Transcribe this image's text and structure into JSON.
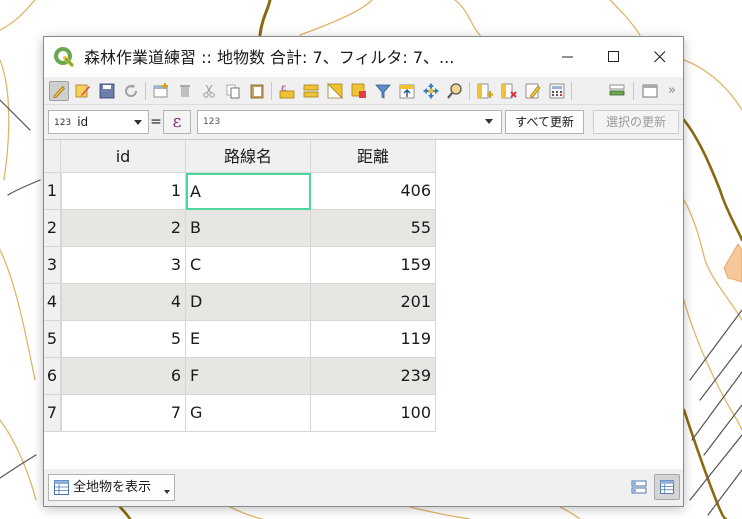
{
  "window": {
    "title": "森林作業道練習 :: 地物数 合計: 7、フィルタ: 7、..."
  },
  "expression_bar": {
    "field_type": "123",
    "field_name": "id",
    "equals": "=",
    "expression_type": "123",
    "update_all_label": "すべて更新",
    "update_selected_label": "選択の更新"
  },
  "table": {
    "columns": [
      "id",
      "路線名",
      "距離"
    ],
    "rows": [
      {
        "row": "1",
        "id": "1",
        "name": "A",
        "distance": "406"
      },
      {
        "row": "2",
        "id": "2",
        "name": "B",
        "distance": "55"
      },
      {
        "row": "3",
        "id": "3",
        "name": "C",
        "distance": "159"
      },
      {
        "row": "4",
        "id": "4",
        "name": "D",
        "distance": "201"
      },
      {
        "row": "5",
        "id": "5",
        "name": "E",
        "distance": "119"
      },
      {
        "row": "6",
        "id": "6",
        "name": "F",
        "distance": "239"
      },
      {
        "row": "7",
        "id": "7",
        "name": "G",
        "distance": "100"
      }
    ]
  },
  "bottom_bar": {
    "show_all_label": "全地物を表示"
  },
  "colors": {
    "selection": "#4bd99b",
    "alt_row": "#e8e6e3",
    "map_contour": "#c8902f",
    "map_contour_dark": "#8a6a10",
    "map_parcel": "#f4c89a"
  }
}
